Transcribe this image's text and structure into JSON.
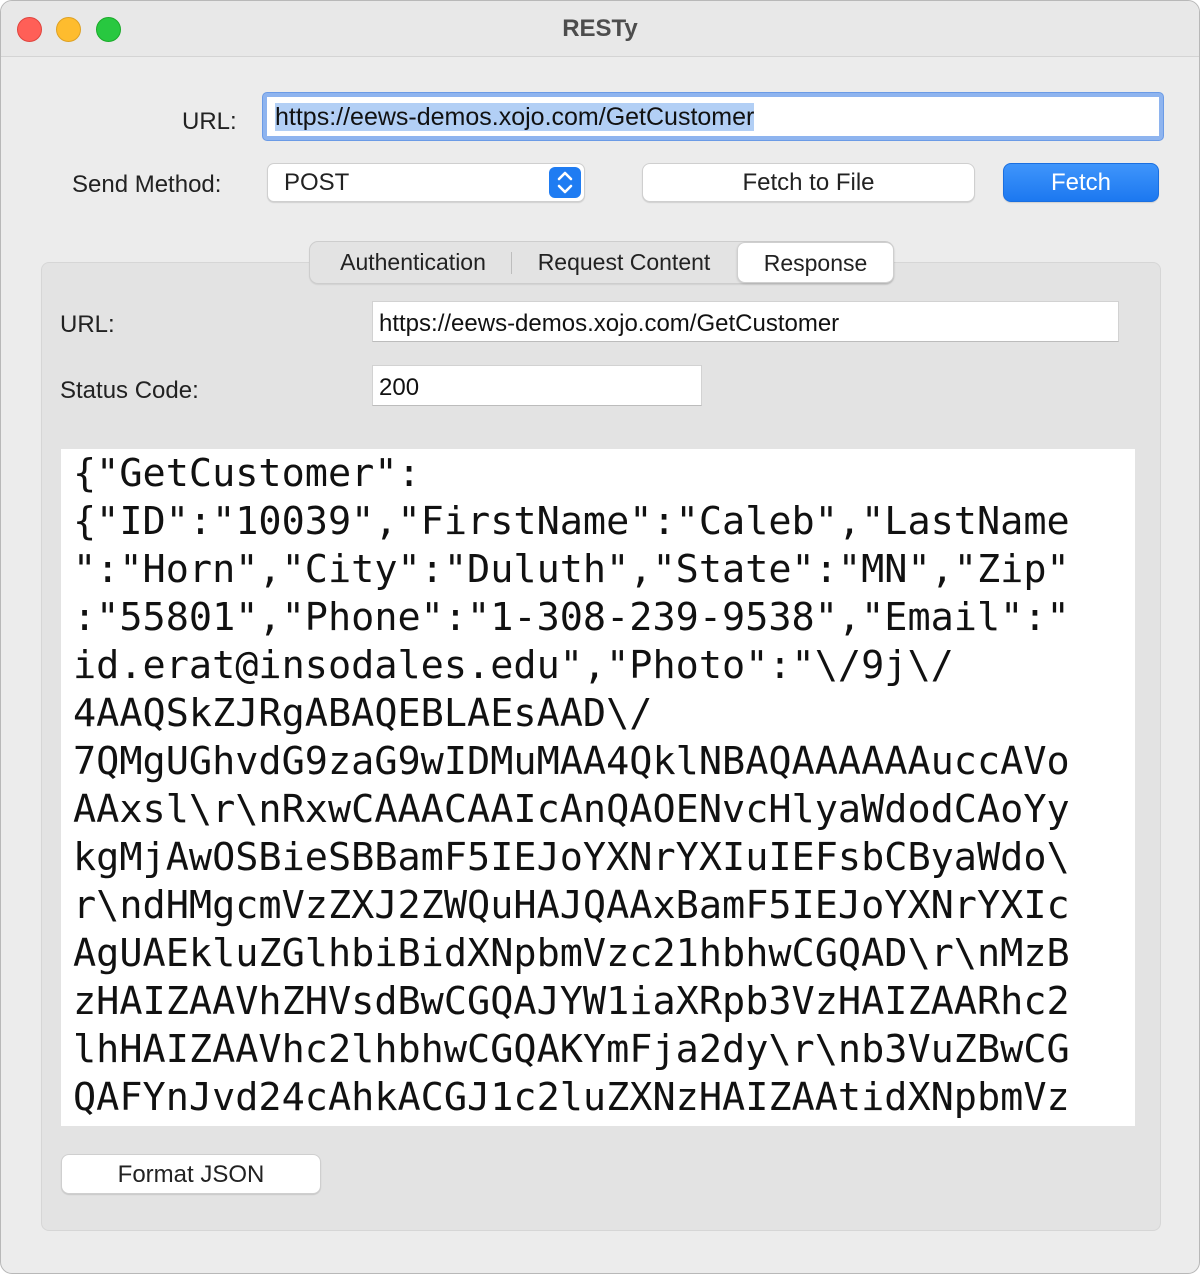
{
  "window": {
    "title": "RESTy"
  },
  "request": {
    "url_label": "URL:",
    "url_value": "https://eews-demos.xojo.com/GetCustomer",
    "method_label": "Send Method:",
    "method_value": "POST",
    "fetch_to_file_label": "Fetch to File",
    "fetch_label": "Fetch"
  },
  "tabs": [
    {
      "label": "Authentication"
    },
    {
      "label": "Request Content"
    },
    {
      "label": "Response"
    }
  ],
  "response": {
    "url_label": "URL:",
    "url_value": "https://eews-demos.xojo.com/GetCustomer",
    "status_label": "Status Code:",
    "status_value": "200",
    "body_lines": [
      "{\"GetCustomer\":",
      "{\"ID\":\"10039\",\"FirstName\":\"Caleb\",\"LastName",
      "\":\"Horn\",\"City\":\"Duluth\",\"State\":\"MN\",\"Zip\"",
      ":\"55801\",\"Phone\":\"1-308-239-9538\",\"Email\":\"",
      "id.erat@insodales.edu\",\"Photo\":\"\\/9j\\/",
      "4AAQSkZJRgABAQEBLAEsAAD\\/",
      "7QMgUGhvdG9zaG9wIDMuMAA4QklNBAQAAAAAAuccAVo",
      "AAxsl\\r\\nRxwCAAACAAIcAnQAOENvcHlyaWdodCAoYy",
      "kgMjAwOSBieSBBamF5IEJoYXNrYXIuIEFsbCByaWdo\\",
      "r\\ndHMgcmVzZXJ2ZWQuHAJQAAxBamF5IEJoYXNrYXIc",
      "AgUAEkluZGlhbiBidXNpbmVzc21hbhwCGQAD\\r\\nMzB",
      "zHAIZAAVhZHVsdBwCGQAJYW1iaXRpb3VzHAIZAARhc2",
      "lhHAIZAAVhc2lhbhwCGQAKYmFja2dy\\r\\nb3VuZBwCG",
      "QAFYnJvd24cAhkACGJ1c2luZXNzHAIZAAtidXNpbmVz"
    ],
    "format_json_label": "Format JSON"
  }
}
